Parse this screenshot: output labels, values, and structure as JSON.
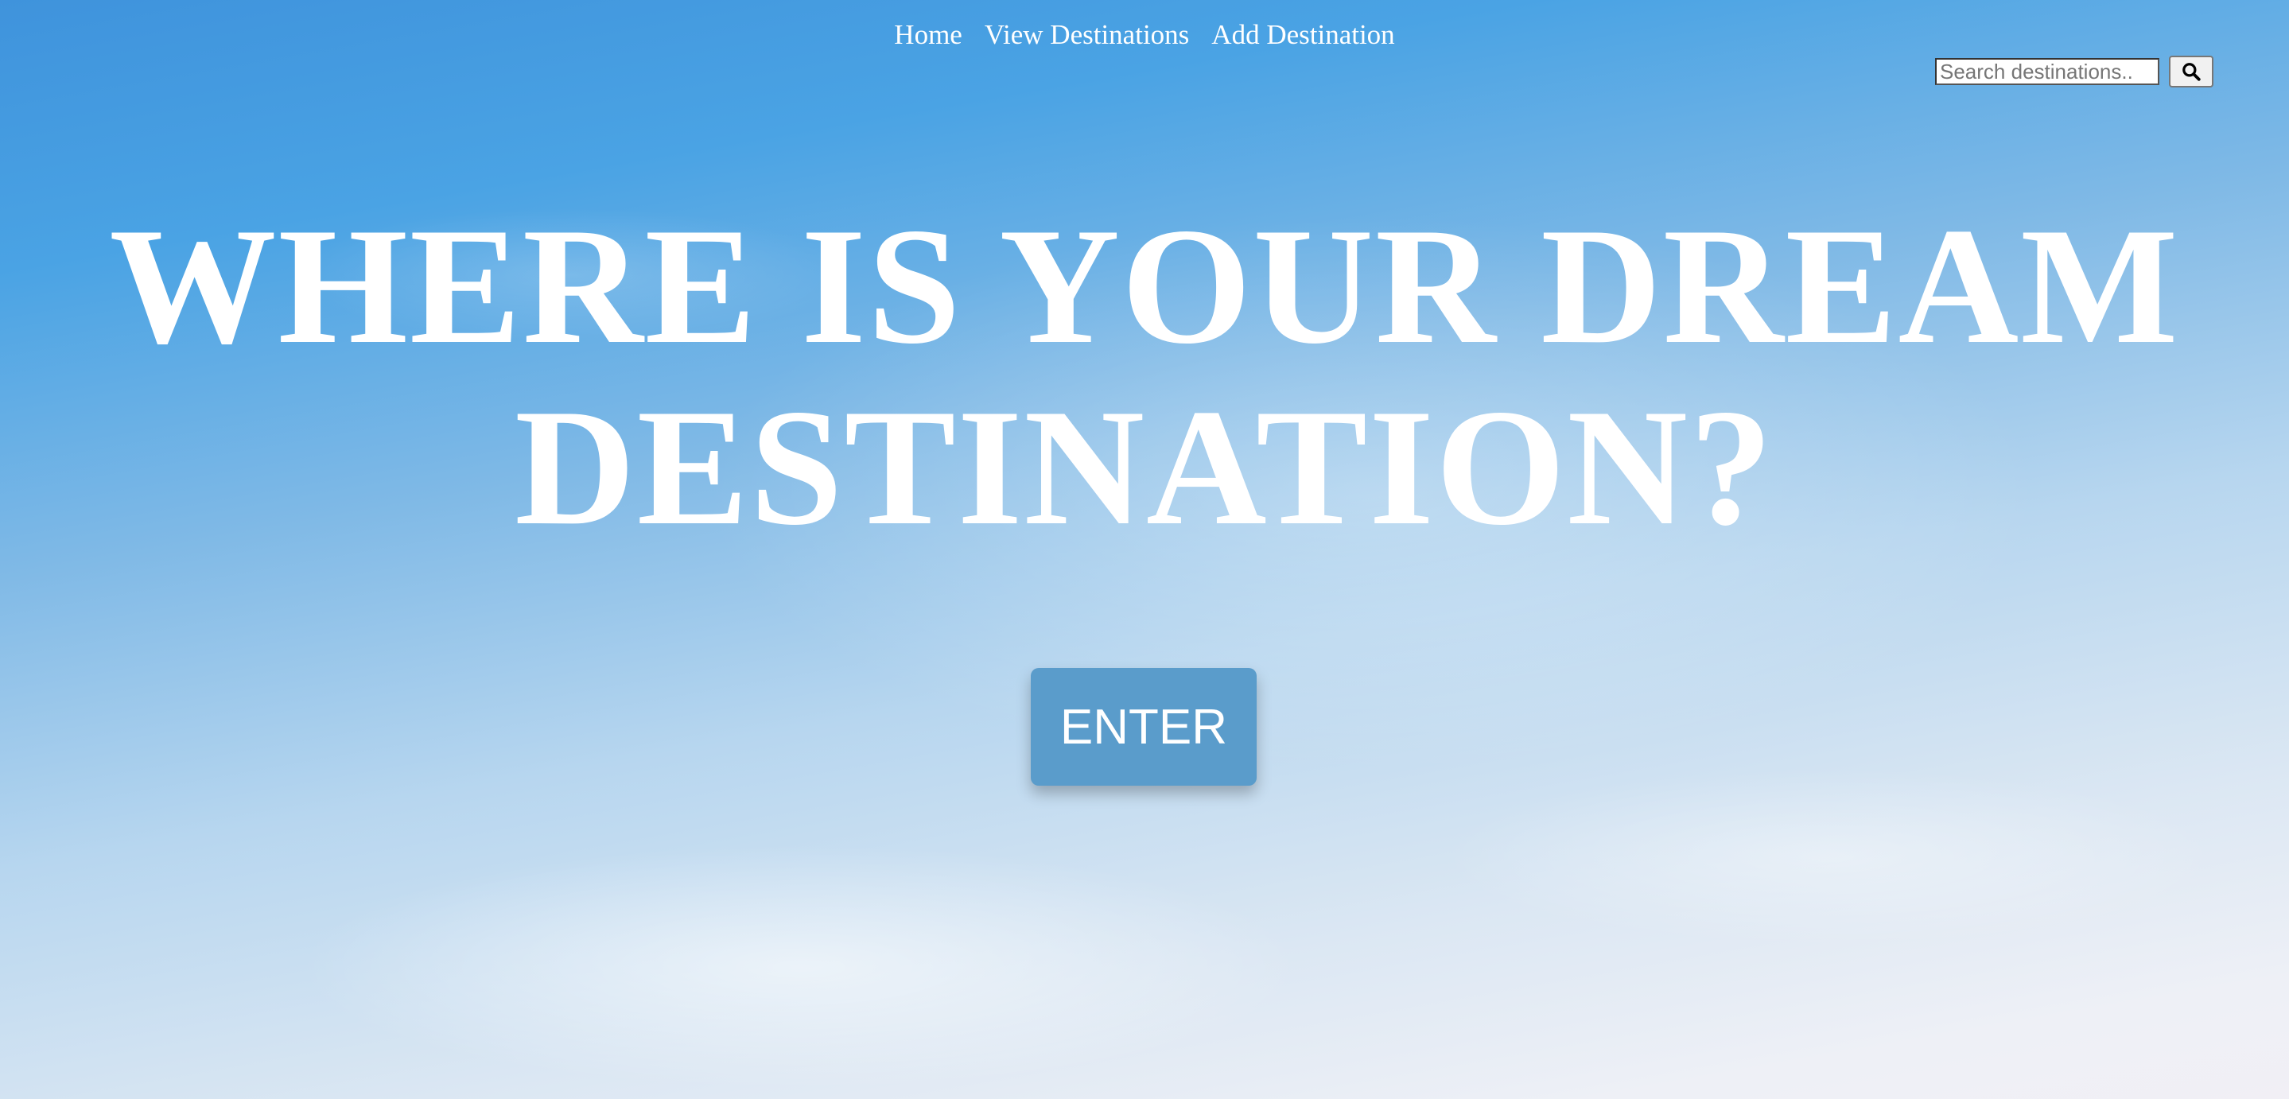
{
  "nav": {
    "items": [
      {
        "label": "Home"
      },
      {
        "label": "View Destinations"
      },
      {
        "label": "Add Destination"
      }
    ]
  },
  "search": {
    "placeholder": "Search destinations..",
    "value": "",
    "icon": "search-icon"
  },
  "hero": {
    "headline": "WHERE IS YOUR DREAM DESTINATION?",
    "button_label": "ENTER"
  },
  "colors": {
    "sky_top": "#3f93dc",
    "sky_bottom": "#f1eff5",
    "button_bg": "#5a9ccb",
    "text": "#ffffff"
  }
}
